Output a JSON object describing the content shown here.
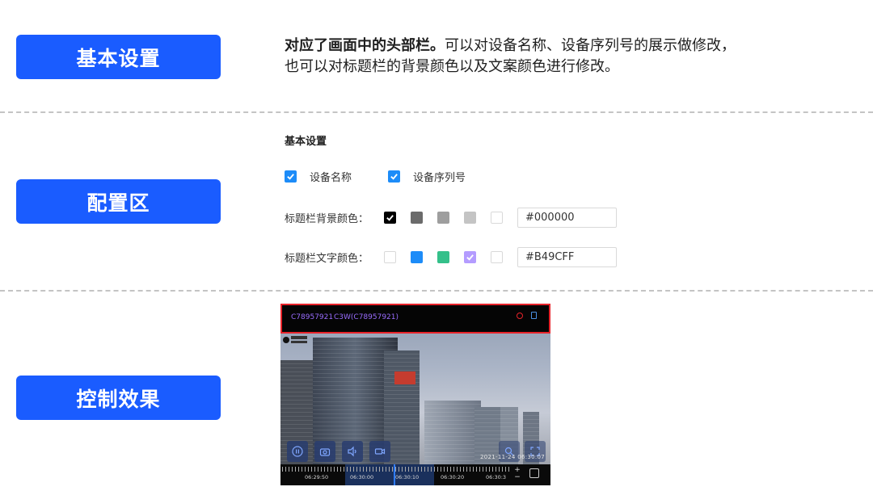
{
  "sections": {
    "basic": "基本设置",
    "config": "配置区",
    "effect": "控制效果"
  },
  "description": {
    "bold": "对应了画面中的头部栏。",
    "rest": "可以对设备名称、设备序列号的展示做修改，",
    "line2": "也可以对标题栏的背景颜色以及文案颜色进行修改。"
  },
  "config_panel": {
    "title": "基本设置",
    "device_name_label": "设备名称",
    "device_name_checked": true,
    "serial_label": "设备序列号",
    "serial_checked": true,
    "bg_color_label": "标题栏背景颜色：",
    "bg_swatches": [
      "#000000",
      "#6b6b6b",
      "#9e9e9e",
      "#c4c4c4",
      "#ffffff"
    ],
    "bg_selected": "#000000",
    "bg_hex_value": "#000000",
    "fg_color_label": "标题栏文字颜色：",
    "fg_swatches": [
      "#ffffff",
      "#1d8cf8",
      "#34c08a",
      "#b49cff",
      "#ffffff"
    ],
    "fg_selected": "#B49CFF",
    "fg_hex_value": "#B49CFF"
  },
  "preview": {
    "serial": "C78957921",
    "device_title": "C3W(C78957921)",
    "timestamp": "2021-11-24 06:30:07",
    "timeline_labels": [
      "06:29:50",
      "06:30:00",
      "06:30:10",
      "06:30:20",
      "06:30:3"
    ],
    "header_text_color": "#9a6dff",
    "header_border_color": "#e8232a"
  },
  "colors": {
    "accent": "#1a5cff",
    "checkbox": "#1d8cf8"
  }
}
